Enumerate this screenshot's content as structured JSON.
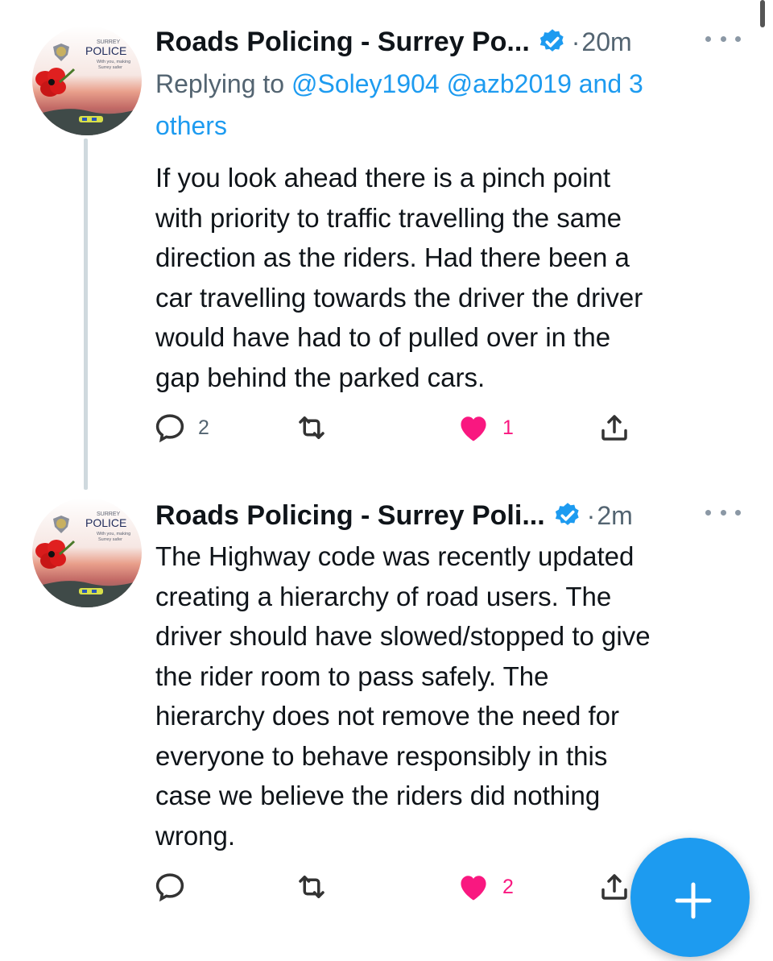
{
  "tweets": [
    {
      "author": "Roads Policing - Surrey Po...",
      "time": "20m",
      "replying_prefix": "Replying to",
      "replying_handles": "@Soley1904 @azb2019",
      "replying_rest_1": "and 3",
      "replying_rest_2": "others",
      "body_lines": [
        "If you look ahead there is a pinch point",
        "with priority to traffic travelling the same",
        "direction as the riders. Had there been a",
        "car travelling towards the driver the driver",
        "would have had to of pulled over in the",
        "gap behind the parked cars."
      ],
      "reply_count": "2",
      "retweet_count": "",
      "like_count": "1"
    },
    {
      "author": "Roads Policing - Surrey Poli...",
      "time": "2m",
      "body_lines": [
        "The Highway code was recently updated",
        "creating a hierarchy of road users. The",
        "driver should have slowed/stopped to give",
        "the rider room to pass safely. The",
        "hierarchy does not remove the need for",
        "everyone to behave responsibly in this",
        "case we believe the riders did nothing",
        "wrong."
      ],
      "reply_count": "",
      "retweet_count": "",
      "like_count": "2"
    }
  ],
  "avatar": {
    "logo_top": "SURREY",
    "logo_name": "POLICE",
    "logo_tagline_1": "With you, making",
    "logo_tagline_2": "Surrey safer"
  },
  "dot_separator": "·",
  "icons": {
    "reply": "reply-icon",
    "retweet": "retweet-icon",
    "like": "heart-icon",
    "share": "share-icon",
    "verified": "verified-badge-icon",
    "more": "more-options-icon",
    "compose": "compose-plus-icon"
  },
  "colors": {
    "accent": "#1d9bf0",
    "like": "#f91880",
    "muted": "#536471",
    "text": "#0f1419"
  }
}
